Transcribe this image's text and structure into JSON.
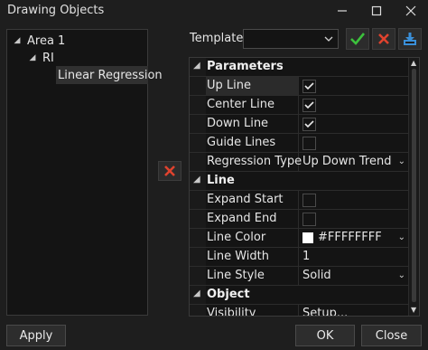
{
  "window": {
    "title": "Drawing Objects"
  },
  "tree": {
    "root": "Area 1",
    "child": "RI",
    "leaf": "Linear Regression"
  },
  "template": {
    "label": "Template",
    "value": ""
  },
  "properties": {
    "sections": {
      "parameters": "Parameters",
      "line": "Line",
      "object": "Object"
    },
    "rows": {
      "up_line": {
        "name": "Up Line",
        "checked": true
      },
      "center_line": {
        "name": "Center Line",
        "checked": true
      },
      "down_line": {
        "name": "Down Line",
        "checked": true
      },
      "guide_lines": {
        "name": "Guide Lines",
        "checked": false
      },
      "regression_type": {
        "name": "Regression Type",
        "value": "Up Down Trend"
      },
      "expand_start": {
        "name": "Expand Start",
        "checked": false
      },
      "expand_end": {
        "name": "Expand End",
        "checked": false
      },
      "line_color": {
        "name": "Line Color",
        "value": "#FFFFFFFF"
      },
      "line_width": {
        "name": "Line Width",
        "value": "1"
      },
      "line_style": {
        "name": "Line Style",
        "value": "Solid"
      },
      "visibility": {
        "name": "Visibility",
        "value": "Setup..."
      }
    }
  },
  "buttons": {
    "apply": "Apply",
    "ok": "OK",
    "close": "Close"
  },
  "colors": {
    "accept": "#3cc13c",
    "remove": "#e0432e",
    "save": "#3a8fd8"
  }
}
